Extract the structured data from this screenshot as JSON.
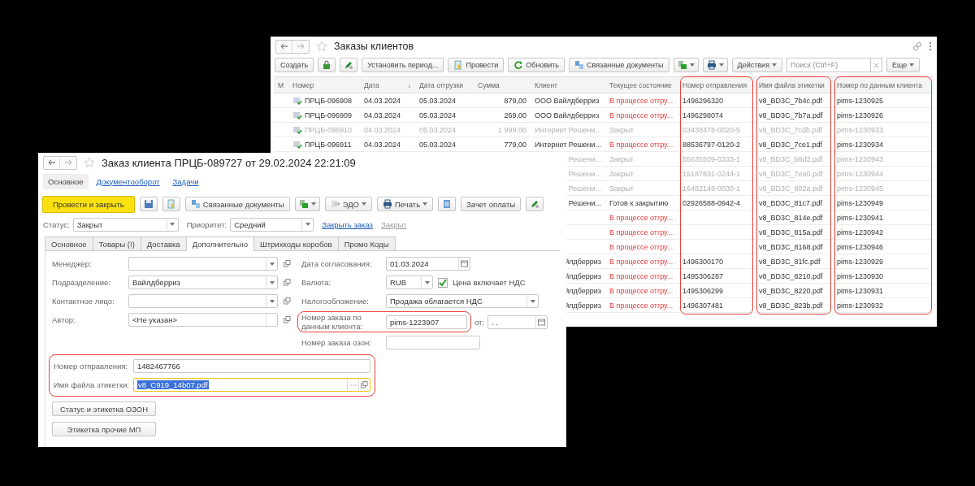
{
  "list_window": {
    "title": "Заказы клиентов",
    "toolbar": [
      {
        "kind": "button",
        "label": "Создать"
      },
      {
        "kind": "lock"
      },
      {
        "kind": "pen"
      },
      {
        "kind": "button",
        "label": "Установить период..."
      },
      {
        "kind": "post",
        "label": "Провести"
      },
      {
        "kind": "refresh",
        "label": "Обновить"
      },
      {
        "kind": "links",
        "label": "Связанные документы"
      },
      {
        "kind": "exchange",
        "menu": true
      },
      {
        "kind": "print",
        "menu": true
      },
      {
        "kind": "button",
        "label": "Действия",
        "menu": true
      },
      {
        "kind": "search",
        "placeholder": "Поиск (Ctrl+F)"
      },
      {
        "kind": "button",
        "label": "Еще",
        "menu": true
      }
    ],
    "table": {
      "columns": [
        {
          "label": "М",
          "kind": "mark",
          "highlighted": false
        },
        {
          "label": "Номер",
          "kind": "doc",
          "highlighted": false
        },
        {
          "label": "Дата",
          "kind": "text",
          "sort_mark": "↓",
          "highlighted": false
        },
        {
          "label": "Дата отгрузки",
          "kind": "text",
          "highlighted": false
        },
        {
          "label": "Сумма",
          "kind": "amount",
          "highlighted": false
        },
        {
          "label": "Клиент",
          "kind": "client",
          "highlighted": false
        },
        {
          "label": "Текущее состояние",
          "kind": "status",
          "highlighted": false
        },
        {
          "label": "Номер отправления",
          "kind": "text",
          "highlighted": true
        },
        {
          "label": "Имя файла этикетки",
          "kind": "text",
          "highlighted": true
        },
        {
          "label": "Номер по данным клиента",
          "kind": "text",
          "highlighted": true
        }
      ],
      "rows": [
        {
          "closed": false,
          "alert": true,
          "cells": [
            null,
            "ПРЦБ-096908",
            "04.03.2024",
            "05.03.2024",
            "879,00",
            "ООО Вайлдберриз",
            "В процессе отгру...",
            "1496296320",
            "v8_BD3C_7b4c.pdf",
            "pims-1230925"
          ]
        },
        {
          "closed": false,
          "alert": true,
          "cells": [
            null,
            "ПРЦБ-096909",
            "04.03.2024",
            "05.03.2024",
            "269,00",
            "ООО Вайлдберриз",
            "В процессе отгру...",
            "1496298074",
            "v8_BD3C_7b7a.pdf",
            "pims-1230926"
          ]
        },
        {
          "closed": true,
          "alert": false,
          "cells": [
            null,
            "ПРЦБ-096910",
            "04.03.2024",
            "05.03.2024",
            "1 999,00",
            "Интернет Решени...",
            "Закрыт",
            "03438478-0020-5",
            "v8_BD3C_7cdb.pdf",
            "pims-1230933"
          ]
        },
        {
          "closed": false,
          "alert": true,
          "cells": [
            null,
            "ПРЦБ-096911",
            "04.03.2024",
            "05.03.2024",
            "779,00",
            "Интернет Решени...",
            "В процессе отгру...",
            "88536797-0120-2",
            "v8_BD3C_7ce1.pdf",
            "pims-1230934"
          ]
        },
        {
          "closed": true,
          "alert": false,
          "cells": [
            null,
            null,
            null,
            null,
            null,
            "Решени...",
            "Закрыт",
            "55635509-0333-1",
            "v8_BD3C_b8d3.pdf",
            "pims-1230943"
          ]
        },
        {
          "closed": true,
          "alert": false,
          "cells": [
            null,
            null,
            null,
            null,
            null,
            "Решени...",
            "Закрыт",
            "15187831-0244-1",
            "v8_BD3C_7ea0.pdf",
            "pims-1230944"
          ]
        },
        {
          "closed": true,
          "alert": false,
          "cells": [
            null,
            null,
            null,
            null,
            null,
            "Решени...",
            "Закрыт",
            "16482148-0030-1",
            "v8_BD3C_802a.pdf",
            "pims-1230945"
          ]
        },
        {
          "closed": false,
          "alert": false,
          "cells": [
            null,
            null,
            null,
            null,
            null,
            "Решени...",
            "Готов к закрытию",
            "02926588-0942-4",
            "v8_BD3C_81c7.pdf",
            "pims-1230949"
          ]
        },
        {
          "closed": false,
          "alert": true,
          "cells": [
            null,
            null,
            null,
            null,
            null,
            null,
            "В процессе отгру...",
            null,
            "v8_BD3C_814e.pdf",
            "pims-1230941"
          ]
        },
        {
          "closed": false,
          "alert": true,
          "cells": [
            null,
            null,
            null,
            null,
            null,
            null,
            "В процессе отгру...",
            null,
            "v8_BD3C_815a.pdf",
            "pims-1230942"
          ]
        },
        {
          "closed": false,
          "alert": true,
          "cells": [
            null,
            null,
            null,
            null,
            null,
            null,
            "В процессе отгру...",
            null,
            "v8_BD3C_8168.pdf",
            "pims-1230946"
          ]
        },
        {
          "closed": false,
          "alert": true,
          "cells": [
            null,
            null,
            null,
            null,
            null,
            "йлдберриз",
            "В процессе отгру...",
            "1496300170",
            "v8_BD3C_81fc.pdf",
            "pims-1230929"
          ]
        },
        {
          "closed": false,
          "alert": true,
          "cells": [
            null,
            null,
            null,
            null,
            null,
            "йлдберриз",
            "В процессе отгру...",
            "1495306287",
            "v8_BD3C_8210.pdf",
            "pims-1230930"
          ]
        },
        {
          "closed": false,
          "alert": true,
          "cells": [
            null,
            null,
            null,
            null,
            null,
            "йлдберриз",
            "В процессе отгру...",
            "1495306299",
            "v8_BD3C_8220.pdf",
            "pims-1230931"
          ]
        },
        {
          "closed": false,
          "alert": true,
          "cells": [
            null,
            null,
            null,
            null,
            null,
            "йлдберриз",
            "В процессе отгру...",
            "1496307481",
            "v8_BD3C_823b.pdf",
            "pims-1230932"
          ]
        }
      ]
    }
  },
  "order_window": {
    "title": "Заказ клиента ПРЦБ-089727 от 29.02.2024 22:21:09",
    "nav": [
      {
        "label": "Основное",
        "selected": true
      },
      {
        "label": "Документооборот",
        "selected": false
      },
      {
        "label": "Задачи",
        "selected": false
      }
    ],
    "toolbar": [
      {
        "kind": "primary",
        "label": "Провести и закрыть"
      },
      {
        "kind": "save"
      },
      {
        "kind": "post"
      },
      {
        "kind": "links",
        "label": "Связанные документы"
      },
      {
        "kind": "exchange",
        "menu": true
      },
      {
        "kind": "edo",
        "label": "ЭДО",
        "menu": true
      },
      {
        "kind": "print",
        "label": "Печать",
        "menu": true
      },
      {
        "kind": "list"
      },
      {
        "kind": "button",
        "label": "Зачет оплаты"
      },
      {
        "kind": "pen"
      }
    ],
    "status": {
      "label": "Статус:",
      "value": "Закрыт"
    },
    "priority": {
      "label": "Приоритет:",
      "value": "Средний"
    },
    "links": [
      {
        "label": "Закрыть заказ",
        "disabled": false
      },
      {
        "label": "Закрыт",
        "disabled": true
      }
    ],
    "tabs": [
      {
        "label": "Основное",
        "selected": false
      },
      {
        "label": "Товары (!)",
        "selected": false
      },
      {
        "label": "Доставка",
        "selected": false
      },
      {
        "label": "Дополнительно",
        "selected": true
      },
      {
        "label": "Штрихкоды коробов",
        "selected": false
      },
      {
        "label": "Промо Коды",
        "selected": false
      }
    ],
    "left_fields": [
      {
        "label": "Менеджер:",
        "dropdown": true
      },
      {
        "label": "Подразделение:",
        "value": "Вайлдберриз",
        "dropdown": true
      },
      {
        "label": "Контактное лицо:",
        "dropdown": true
      },
      {
        "label": "Автор:",
        "value": "<Не указан>",
        "dropdown": false
      }
    ],
    "right_fields": [
      {
        "kind": "date",
        "label": "Дата согласования:",
        "value": "01.03.2024",
        "highlighted": false
      },
      {
        "kind": "currency",
        "label": "Валюта:",
        "value": "RUB",
        "checkbox": {
          "label": "Цена включает НДС",
          "checked": true
        },
        "highlighted": false
      },
      {
        "kind": "select",
        "label": "Налогообложение:",
        "value": "Продажа облагается НДС",
        "highlighted": false
      },
      {
        "kind": "text_date",
        "label": "Номер заказа по данным клиента:",
        "value": "pims-1223907",
        "date_label": "от:",
        "date_value": ".  .",
        "highlighted": true
      },
      {
        "kind": "text",
        "label": "Номер заказа озон:",
        "highlighted": false
      }
    ],
    "shipment_group": {
      "highlighted": true,
      "fields": [
        {
          "label": "Номер отправления:",
          "value": "1482467766",
          "focused": false
        },
        {
          "label": "Имя файла этикетки:",
          "value": "v8_C919_14b07.pdf",
          "focused": true
        }
      ]
    },
    "buttons": [
      "Статус и этикетка ОЗОН",
      "Этикетка прочие МП"
    ]
  }
}
